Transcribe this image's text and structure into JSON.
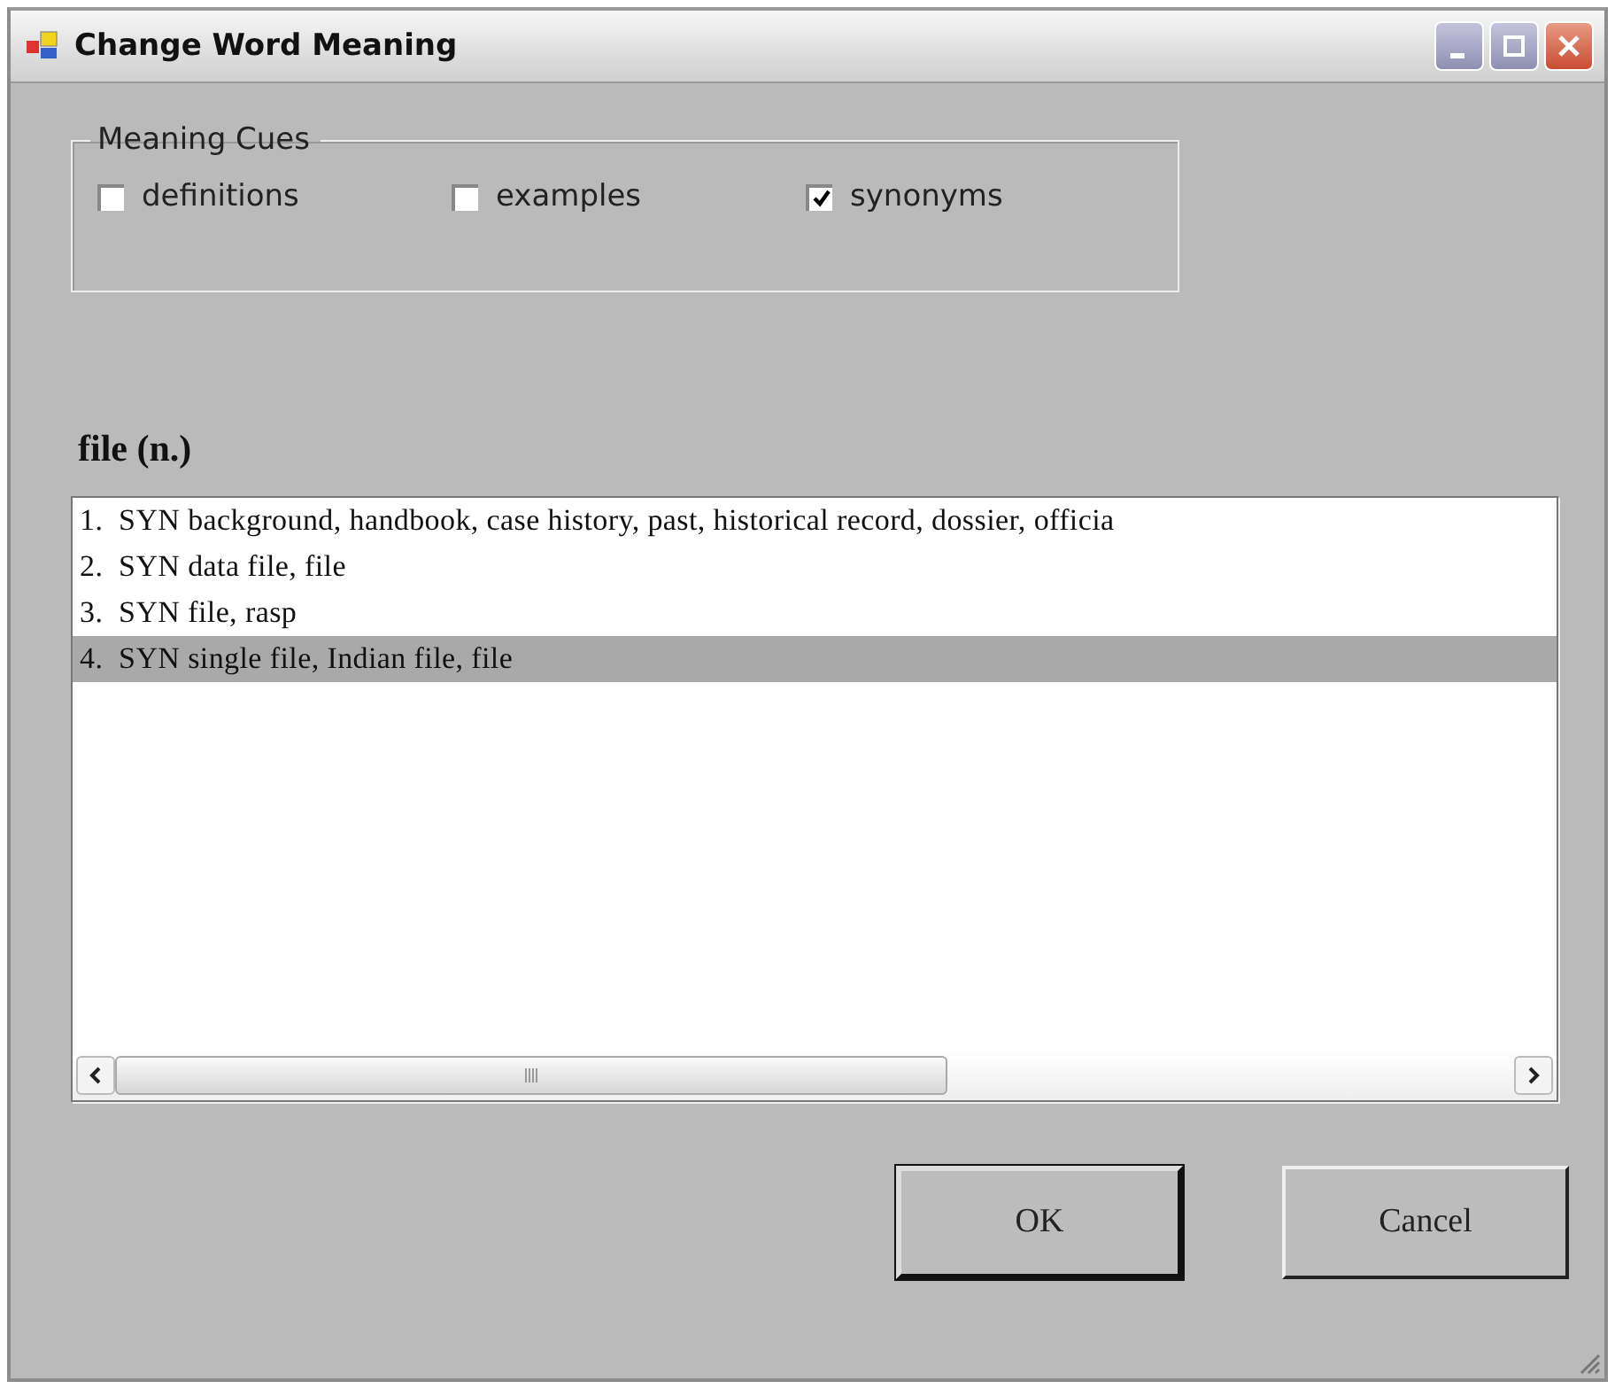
{
  "window": {
    "title": "Change Word Meaning"
  },
  "meaning_cues": {
    "title": "Meaning Cues",
    "options": [
      {
        "label": "definitions",
        "checked": false
      },
      {
        "label": "examples",
        "checked": false
      },
      {
        "label": "synonyms",
        "checked": true
      }
    ]
  },
  "word_heading": "file (n.)",
  "senses": [
    {
      "text": "1.  SYN background, handbook, case history, past, historical record, dossier, officia",
      "selected": false
    },
    {
      "text": "2.  SYN data file, file",
      "selected": false
    },
    {
      "text": "3.  SYN file, rasp",
      "selected": false
    },
    {
      "text": "4.  SYN single file, Indian file, file",
      "selected": true
    }
  ],
  "buttons": [
    {
      "label": "OK",
      "kind": "default"
    },
    {
      "label": "Cancel",
      "kind": "normal"
    }
  ]
}
